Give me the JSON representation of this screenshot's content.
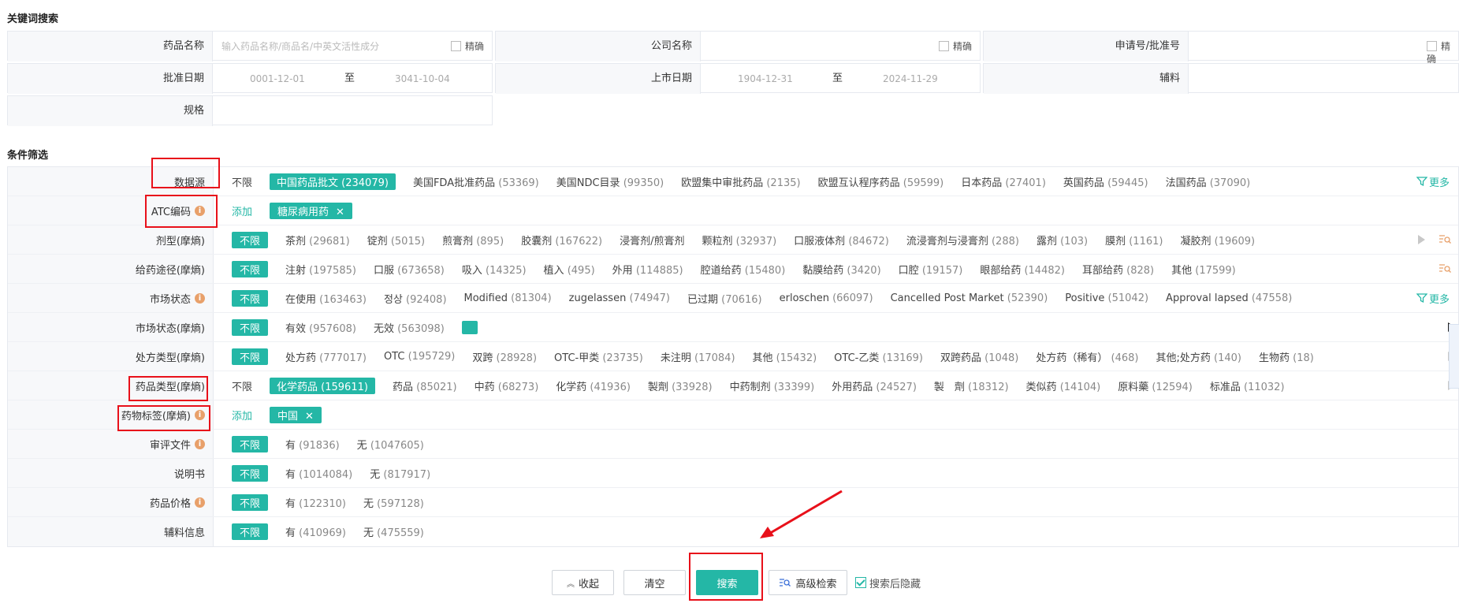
{
  "sections": {
    "keyword": "关键词搜索",
    "filter": "条件筛选"
  },
  "keyword": {
    "drug_name": {
      "label": "药品名称",
      "placeholder": "输入药品名称/商品名/中英文活性成分",
      "precise": "精确"
    },
    "company": {
      "label": "公司名称",
      "precise": "精确"
    },
    "app_no": {
      "label": "申请号/批准号",
      "precise": "精确"
    },
    "approve_date": {
      "label": "批准日期",
      "from": "0001-12-01",
      "to_label": "至",
      "to": "3041-10-04"
    },
    "market_date": {
      "label": "上市日期",
      "from": "1904-12-31",
      "to_label": "至",
      "to": "2024-11-29"
    },
    "excipient": {
      "label": "辅料"
    },
    "spec": {
      "label": "规格"
    }
  },
  "filters": {
    "datasource": {
      "label": "数据源",
      "unlimited": "不限",
      "options": [
        {
          "name": "中国药品批文",
          "count": "(234079)",
          "selected": true
        },
        {
          "name": "美国FDA批准药品",
          "count": "(53369)"
        },
        {
          "name": "美国NDC目录",
          "count": "(99350)"
        },
        {
          "name": "欧盟集中审批药品",
          "count": "(2135)"
        },
        {
          "name": "欧盟互认程序药品",
          "count": "(59599)"
        },
        {
          "name": "日本药品",
          "count": "(27401)"
        },
        {
          "name": "英国药品",
          "count": "(59445)"
        },
        {
          "name": "法国药品",
          "count": "(37090)"
        }
      ],
      "more": "更多"
    },
    "atc": {
      "label": "ATC编码",
      "add": "添加",
      "tag": "糖尿病用药",
      "tag_close": "✕"
    },
    "dosage": {
      "label": "剂型(摩熵)",
      "unlimited": "不限",
      "options": [
        {
          "name": "茶剂",
          "count": "(29681)"
        },
        {
          "name": "锭剂",
          "count": "(5015)"
        },
        {
          "name": "煎膏剂",
          "count": "(895)"
        },
        {
          "name": "胶囊剂",
          "count": "(167622)"
        },
        {
          "name": "浸膏剂/煎膏剂",
          "count": ""
        },
        {
          "name": "颗粒剂",
          "count": "(32937)"
        },
        {
          "name": "口服液体剂",
          "count": "(84672)"
        },
        {
          "name": "流浸膏剂与浸膏剂",
          "count": "(288)"
        },
        {
          "name": "露剂",
          "count": "(103)"
        },
        {
          "name": "膜剂",
          "count": "(1161)"
        },
        {
          "name": "凝胶剂",
          "count": "(19609)"
        }
      ]
    },
    "route": {
      "label": "给药途径(摩熵)",
      "unlimited": "不限",
      "options": [
        {
          "name": "注射",
          "count": "(197585)"
        },
        {
          "name": "口服",
          "count": "(673658)"
        },
        {
          "name": "吸入",
          "count": "(14325)"
        },
        {
          "name": "植入",
          "count": "(495)"
        },
        {
          "name": "外用",
          "count": "(114885)"
        },
        {
          "name": "腔道给药",
          "count": "(15480)"
        },
        {
          "name": "黏膜给药",
          "count": "(3420)"
        },
        {
          "name": "口腔",
          "count": "(19157)"
        },
        {
          "name": "眼部给药",
          "count": "(14482)"
        },
        {
          "name": "耳部给药",
          "count": "(828)"
        },
        {
          "name": "其他",
          "count": "(17599)"
        }
      ]
    },
    "market_status": {
      "label": "市场状态",
      "unlimited": "不限",
      "options": [
        {
          "name": "在使用",
          "count": "(163463)"
        },
        {
          "name": "정상",
          "count": "(92408)"
        },
        {
          "name": "Modified",
          "count": "(81304)"
        },
        {
          "name": "zugelassen",
          "count": "(74947)"
        },
        {
          "name": "已过期",
          "count": "(70616)"
        },
        {
          "name": "erloschen",
          "count": "(66097)"
        },
        {
          "name": "Cancelled Post Market",
          "count": "(52390)"
        },
        {
          "name": "Positive",
          "count": "(51042)"
        },
        {
          "name": "Approval lapsed",
          "count": "(47558)"
        }
      ],
      "more": "更多"
    },
    "market_status_ms": {
      "label": "市场状态(摩熵)",
      "unlimited": "不限",
      "options": [
        {
          "name": "有效",
          "count": "(957608)"
        },
        {
          "name": "无效",
          "count": "(563098)"
        }
      ]
    },
    "rx_type": {
      "label": "处方类型(摩熵)",
      "unlimited": "不限",
      "options": [
        {
          "name": "处方药",
          "count": "(777017)"
        },
        {
          "name": "OTC",
          "count": "(195729)"
        },
        {
          "name": "双跨",
          "count": "(28928)"
        },
        {
          "name": "OTC-甲类",
          "count": "(23735)"
        },
        {
          "name": "未注明",
          "count": "(17084)"
        },
        {
          "name": "其他",
          "count": "(15432)"
        },
        {
          "name": "OTC-乙类",
          "count": "(13169)"
        },
        {
          "name": "双跨药品",
          "count": "(1048)"
        },
        {
          "name": "处方药（稀有）",
          "count": "(468)"
        },
        {
          "name": "其他;处方药",
          "count": "(140)"
        },
        {
          "name": "生物药",
          "count": "(18)"
        }
      ]
    },
    "drug_type": {
      "label": "药品类型(摩熵)",
      "unlimited": "不限",
      "options": [
        {
          "name": "化学药品",
          "count": "(159611)",
          "selected": true
        },
        {
          "name": "药品",
          "count": "(85021)"
        },
        {
          "name": "中药",
          "count": "(68273)"
        },
        {
          "name": "化学药",
          "count": "(41936)"
        },
        {
          "name": "製劑",
          "count": "(33928)"
        },
        {
          "name": "中药制剂",
          "count": "(33399)"
        },
        {
          "name": "外用药品",
          "count": "(24527)"
        },
        {
          "name": "製　劑",
          "count": "(18312)"
        },
        {
          "name": "类似药",
          "count": "(14104)"
        },
        {
          "name": "原料藥",
          "count": "(12594)"
        },
        {
          "name": "标准品",
          "count": "(11032)"
        }
      ]
    },
    "drug_tag": {
      "label": "药物标签(摩熵)",
      "add": "添加",
      "tag": "中国",
      "tag_close": "✕"
    },
    "review": {
      "label": "审评文件",
      "unlimited": "不限",
      "options": [
        {
          "name": "有",
          "count": "(91836)"
        },
        {
          "name": "无",
          "count": "(1047605)"
        }
      ]
    },
    "manual": {
      "label": "说明书",
      "unlimited": "不限",
      "options": [
        {
          "name": "有",
          "count": "(1014084)"
        },
        {
          "name": "无",
          "count": "(817917)"
        }
      ]
    },
    "price": {
      "label": "药品价格",
      "unlimited": "不限",
      "options": [
        {
          "name": "有",
          "count": "(122310)"
        },
        {
          "name": "无",
          "count": "(597128)"
        }
      ]
    },
    "excipient_info": {
      "label": "辅料信息",
      "unlimited": "不限",
      "options": [
        {
          "name": "有",
          "count": "(410969)"
        },
        {
          "name": "无",
          "count": "(475559)"
        }
      ]
    }
  },
  "buttons": {
    "collapse": "收起",
    "clear": "清空",
    "search": "搜索",
    "advanced": "高级检索",
    "hide_after": "搜索后隐藏"
  },
  "colors": {
    "accent": "#24b7a6",
    "highlight": "#e8101a",
    "info": "#e8a06a"
  }
}
